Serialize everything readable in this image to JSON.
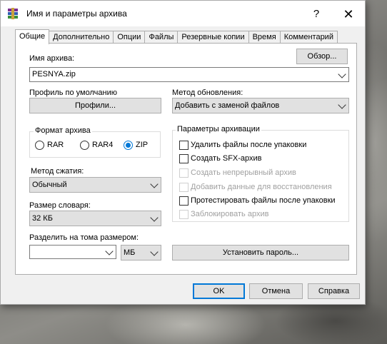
{
  "window": {
    "title": "Имя и параметры архива",
    "help_glyph": "?",
    "close_glyph": "✕"
  },
  "tabs": [
    {
      "label": "Общие",
      "active": true
    },
    {
      "label": "Дополнительно",
      "active": false
    },
    {
      "label": "Опции",
      "active": false
    },
    {
      "label": "Файлы",
      "active": false
    },
    {
      "label": "Резервные копии",
      "active": false
    },
    {
      "label": "Время",
      "active": false
    },
    {
      "label": "Комментарий",
      "active": false
    }
  ],
  "archive": {
    "name_label": "Имя архива:",
    "browse_label": "Обзор...",
    "name_value": "PESNYA.zip"
  },
  "profile": {
    "label": "Профиль по умолчанию",
    "button": "Профили..."
  },
  "update": {
    "label": "Метод обновления:",
    "value": "Добавить с заменой файлов"
  },
  "format": {
    "label": "Формат архива",
    "options": [
      {
        "label": "RAR",
        "selected": false
      },
      {
        "label": "RAR4",
        "selected": false
      },
      {
        "label": "ZIP",
        "selected": true
      }
    ]
  },
  "compression": {
    "label": "Метод сжатия:",
    "value": "Обычный"
  },
  "dictionary": {
    "label": "Размер словаря:",
    "value": "32 КБ"
  },
  "split": {
    "label": "Разделить на тома размером:",
    "value": "",
    "unit": "МБ"
  },
  "options": {
    "title": "Параметры архивации",
    "items": [
      {
        "label": "Удалить файлы после упаковки",
        "enabled": true,
        "checked": false
      },
      {
        "label": "Создать SFX-архив",
        "enabled": true,
        "checked": false
      },
      {
        "label": "Создать непрерывный архив",
        "enabled": false,
        "checked": false
      },
      {
        "label": "Добавить данные для восстановления",
        "enabled": false,
        "checked": false
      },
      {
        "label": "Протестировать файлы после упаковки",
        "enabled": true,
        "checked": false
      },
      {
        "label": "Заблокировать архив",
        "enabled": false,
        "checked": false
      }
    ]
  },
  "password_button": "Установить пароль...",
  "footer": {
    "ok": "OK",
    "cancel": "Отмена",
    "help": "Справка"
  },
  "colors": {
    "accent": "#0078d7",
    "window_bg": "#f0f0f0",
    "button_bg": "#e1e1e1"
  }
}
